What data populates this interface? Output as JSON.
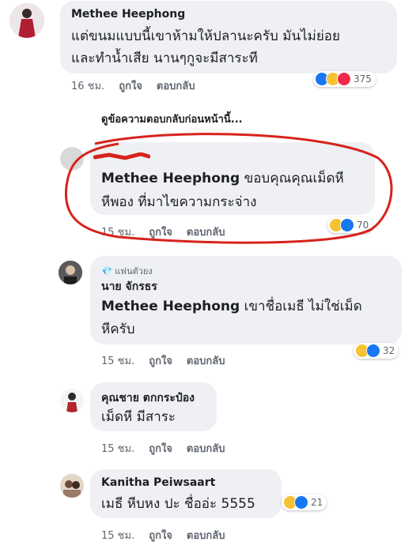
{
  "comments": [
    {
      "name": "Methee Heephong",
      "line1": "แต่ขนมแบบนี้เขาห้ามให้ปลานะครับ มันไม่ย่อย",
      "line2": "และทำน้ำเสีย นานๆกูจะมีสาระที",
      "time": "16 ชม.",
      "like": "ถูกใจ",
      "reply": "ตอบกลับ",
      "reactions": [
        "like-icon",
        "haha-icon",
        "love-icon"
      ],
      "count": "375"
    },
    {
      "mention": "Methee Heephong",
      "line1_rest": " ขอบคุณคุณเม็ดหี",
      "line2": "หีพอง ที่มาไขความกระจ่าง",
      "time": "15 ชม.",
      "like": "ถูกใจ",
      "reply": "ตอบกลับ",
      "reactions": [
        "haha-icon",
        "like-icon"
      ],
      "count": "70"
    },
    {
      "badge": "แฟนตัวยง",
      "name": "นาย จักรธร",
      "mention": "Methee Heephong",
      "line1_rest": " เขาชื่อเมธี ไม่ใช่เม็ด",
      "line2": "หีครับ",
      "time": "15 ชม.",
      "like": "ถูกใจ",
      "reply": "ตอบกลับ",
      "reactions": [
        "haha-icon",
        "like-icon"
      ],
      "count": "32"
    },
    {
      "name": "คุณชาย ตกกระป๋อง",
      "line1": "เม็ดหี มีสาระ",
      "time": "15 ชม.",
      "like": "ถูกใจ",
      "reply": "ตอบกลับ"
    },
    {
      "name": "Kanitha Peiwsaart",
      "line1": "เมธี หีบหง ปะ ชื่ออ่ะ 5555",
      "time": "15 ชม.",
      "like": "ถูกใจ",
      "reply": "ตอบกลับ",
      "reactions": [
        "haha-icon",
        "like-icon"
      ],
      "count": "21"
    }
  ],
  "view_previous": "ดูข้อความตอบกลับก่อนหน้านี้...",
  "colors": {
    "annotation_red": "#d6231c",
    "like_blue": "#1877f2",
    "haha_yellow": "#f7c232",
    "love_red": "#f0284a"
  }
}
